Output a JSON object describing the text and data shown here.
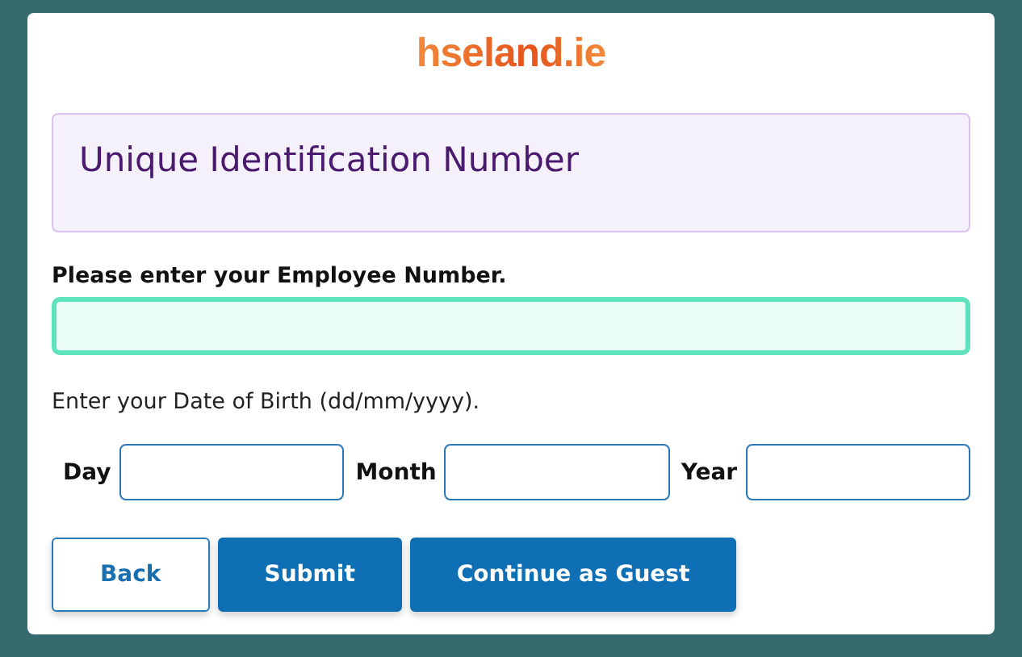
{
  "logo": "hseland.ie",
  "heading": "Unique Identification Number",
  "employee_field": {
    "label": "Please enter your Employee Number.",
    "focused": true
  },
  "dob_prompt": "Enter your Date of Birth (dd/mm/yyyy).",
  "date_fields": [
    {
      "label": "Day"
    },
    {
      "label": "Month"
    },
    {
      "label": "Year"
    }
  ],
  "buttons": [
    {
      "label": "Back",
      "kind": "secondary"
    },
    {
      "label": "Submit",
      "kind": "primary"
    },
    {
      "label": "Continue as Guest",
      "kind": "primary"
    }
  ]
}
